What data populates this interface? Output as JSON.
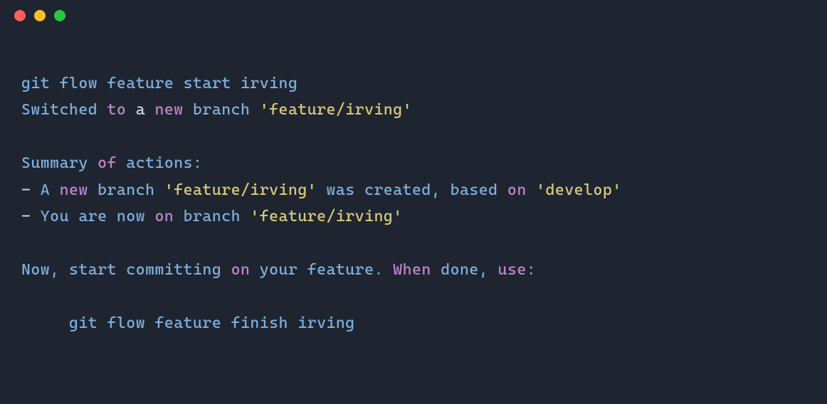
{
  "terminal": {
    "lines": [
      {
        "segments": [
          {
            "text": "git flow feature start irving",
            "cls": "c-blue"
          }
        ]
      },
      {
        "segments": [
          {
            "text": "Switched ",
            "cls": "c-blue"
          },
          {
            "text": "to",
            "cls": "c-purple"
          },
          {
            "text": " a ",
            "cls": "c-white"
          },
          {
            "text": "new",
            "cls": "c-purple"
          },
          {
            "text": " branch ",
            "cls": "c-blue"
          },
          {
            "text": "'feature/irving'",
            "cls": "c-yellow"
          }
        ]
      },
      {
        "segments": []
      },
      {
        "segments": [
          {
            "text": "Summary ",
            "cls": "c-blue"
          },
          {
            "text": "of",
            "cls": "c-purple"
          },
          {
            "text": " actions:",
            "cls": "c-blue"
          }
        ]
      },
      {
        "segments": [
          {
            "text": "- ",
            "cls": "c-white"
          },
          {
            "text": "A ",
            "cls": "c-blue"
          },
          {
            "text": "new",
            "cls": "c-purple"
          },
          {
            "text": " branch ",
            "cls": "c-blue"
          },
          {
            "text": "'feature/irving'",
            "cls": "c-yellow"
          },
          {
            "text": " was created, based ",
            "cls": "c-blue"
          },
          {
            "text": "on",
            "cls": "c-purple"
          },
          {
            "text": " ",
            "cls": "c-white"
          },
          {
            "text": "'develop'",
            "cls": "c-yellow"
          }
        ]
      },
      {
        "segments": [
          {
            "text": "- ",
            "cls": "c-white"
          },
          {
            "text": "You are now ",
            "cls": "c-blue"
          },
          {
            "text": "on",
            "cls": "c-purple"
          },
          {
            "text": " branch ",
            "cls": "c-blue"
          },
          {
            "text": "'feature/irving'",
            "cls": "c-yellow"
          }
        ]
      },
      {
        "segments": []
      },
      {
        "segments": [
          {
            "text": "Now, start committing ",
            "cls": "c-blue"
          },
          {
            "text": "on",
            "cls": "c-purple"
          },
          {
            "text": " your feature. ",
            "cls": "c-blue"
          },
          {
            "text": "When",
            "cls": "c-purple"
          },
          {
            "text": " done, ",
            "cls": "c-blue"
          },
          {
            "text": "use",
            "cls": "c-purple"
          },
          {
            "text": ":",
            "cls": "c-blue"
          }
        ]
      },
      {
        "segments": []
      },
      {
        "segments": [
          {
            "text": "     git flow feature finish irving",
            "cls": "c-blue"
          }
        ]
      }
    ]
  }
}
